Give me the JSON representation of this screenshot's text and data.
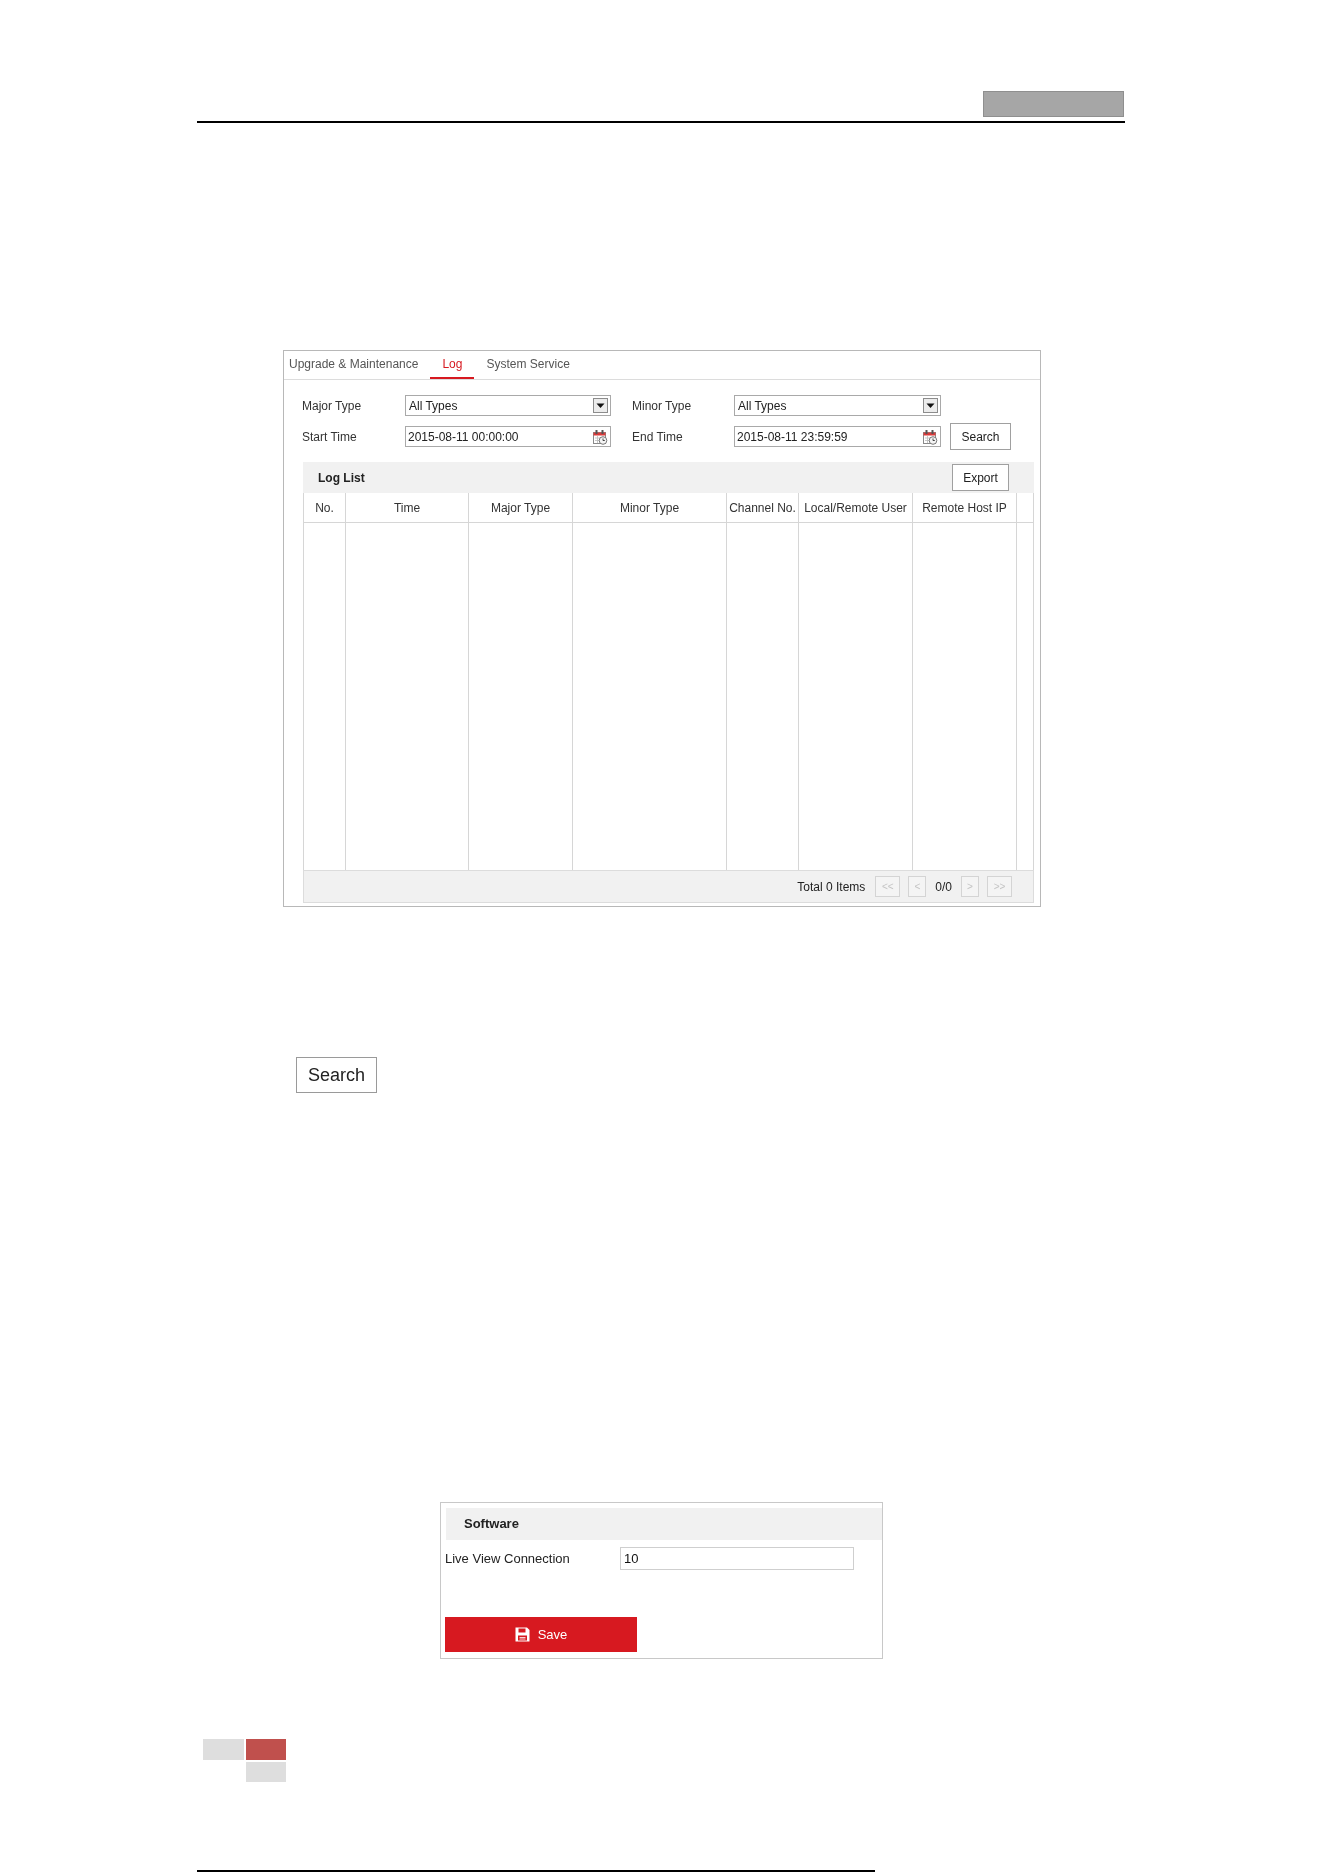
{
  "log_panel": {
    "tabs": [
      {
        "label": "Upgrade & Maintenance",
        "selected": false
      },
      {
        "label": "Log",
        "selected": true
      },
      {
        "label": "System Service",
        "selected": false
      }
    ],
    "filters": [
      {
        "label": "Major Type",
        "kind": "select",
        "value": "All Types"
      },
      {
        "label": "Minor Type",
        "kind": "select",
        "value": "All Types"
      },
      {
        "label": "Start Time",
        "kind": "date",
        "value": "2015-08-11 00:00:00"
      },
      {
        "label": "End Time",
        "kind": "date",
        "value": "2015-08-11 23:59:59"
      }
    ],
    "search_button": "Search",
    "log_list": {
      "title": "Log List",
      "export_button": "Export",
      "columns": [
        "No.",
        "Time",
        "Major Type",
        "Minor Type",
        "Channel No.",
        "Local/Remote User",
        "Remote Host IP"
      ],
      "total": "Total 0 Items",
      "pagination": {
        "first": {
          "label": "<<",
          "disabled": true
        },
        "previous": {
          "label": "<",
          "disabled": true
        },
        "page": "0/0",
        "next": {
          "label": ">",
          "disabled": true
        },
        "last": {
          "label": ">>",
          "disabled": true
        }
      }
    }
  },
  "search_button": "Search",
  "software_panel": {
    "title": "Software",
    "fields": [
      {
        "label": "Live View Connection",
        "value": "10"
      }
    ],
    "save_button": "Save"
  }
}
